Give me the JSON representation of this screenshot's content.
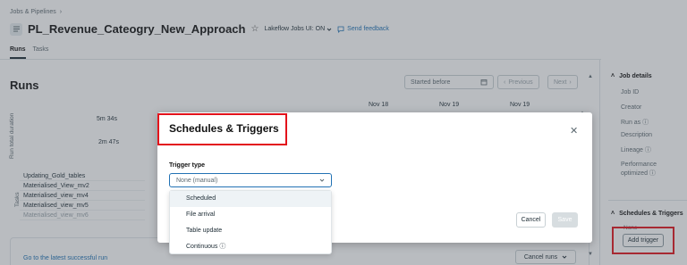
{
  "breadcrumb": {
    "label": "Jobs & Pipelines",
    "sep": "›"
  },
  "header": {
    "title": "PL_Revenue_Cateogry_New_Approach",
    "star": "☆",
    "lakeflow_toggle": "Lakeflow Jobs UI: ON",
    "send_feedback": "Send feedback"
  },
  "tabs": [
    {
      "label": "Runs"
    },
    {
      "label": "Tasks"
    }
  ],
  "runs": {
    "heading": "Runs",
    "filter_placeholder": "Started before",
    "previous": "Previous",
    "next": "Next",
    "dates": [
      "Nov 18",
      "Nov 19",
      "Nov 19"
    ],
    "axis_label": "Run total duration",
    "durations": [
      "5m 34s",
      "2m 47s"
    ],
    "tasks_axis_label": "Tasks",
    "tasks": [
      "Updating_Gold_tables",
      "Materialised_View_mv2",
      "Materialised_view_mv4",
      "Materialised_view_mv5",
      "Materialised_view_mv6"
    ],
    "latest_run_link": "Go to the latest successful run",
    "cancel_runs": "Cancel runs"
  },
  "right_panel": {
    "job_details": "Job details",
    "fields": [
      "Job ID",
      "Creator",
      "Run as",
      "Description",
      "Lineage",
      "Performance optimized"
    ],
    "schedules_title": "Schedules & Triggers",
    "schedules_value": "None",
    "add_trigger": "Add trigger"
  },
  "modal": {
    "title": "Schedules & Triggers",
    "trigger_type_label": "Trigger type",
    "selected": "None (manual)",
    "options": [
      "Scheduled",
      "File arrival",
      "Table update",
      "Continuous"
    ],
    "cancel": "Cancel",
    "save": "Save"
  },
  "colors": {
    "accent": "#2272b4",
    "highlight_red": "#e3121b",
    "link": "#1a6fb3"
  }
}
